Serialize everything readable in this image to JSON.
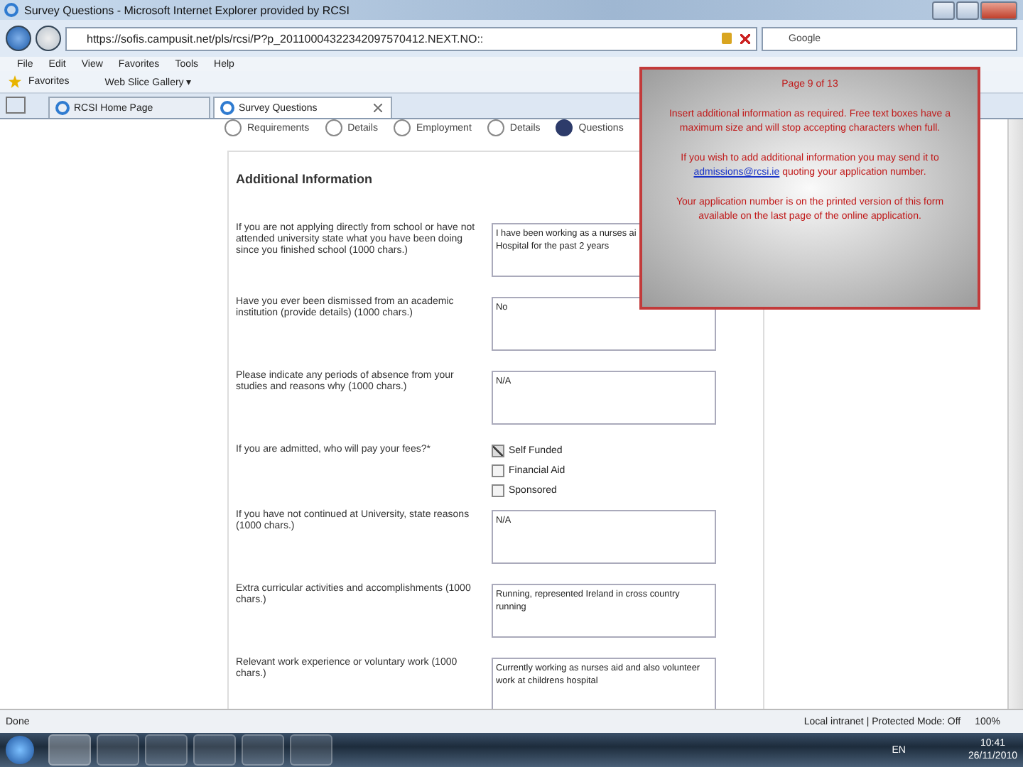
{
  "window": {
    "title": "Survey Questions - Microsoft Internet Explorer provided by RCSI"
  },
  "address_bar": {
    "url": "https://sofis.campusit.net/pls/rcsi/P?p_20110004322342097570412.NEXT.NO::",
    "search_placeholder": "Google"
  },
  "menu": [
    "File",
    "Edit",
    "View",
    "Favorites",
    "Tools",
    "Help"
  ],
  "favorites_bar": {
    "favorites": "Favorites",
    "web_slice": "Web Slice Gallery ▾"
  },
  "tabs": [
    {
      "label": "RCSI Home Page",
      "selected": false
    },
    {
      "label": "Survey Questions",
      "selected": true
    }
  ],
  "steps": [
    {
      "label": "Requirements",
      "selected": false
    },
    {
      "label": "Details",
      "selected": false
    },
    {
      "label": "Employment",
      "selected": false
    },
    {
      "label": "Details",
      "selected": false
    },
    {
      "label": "Questions",
      "selected": true
    }
  ],
  "form": {
    "heading": "Additional Information",
    "questions": [
      {
        "kind": "textarea",
        "label": "If you are not applying directly from school or have not attended university state what you have been doing since you finished school (1000 chars.)",
        "value": "I have been working as a nurses ai\nHospital for the past 2 years"
      },
      {
        "kind": "textarea",
        "label": "Have you ever been dismissed from an academic institution (provide details) (1000 chars.)",
        "value": "No"
      },
      {
        "kind": "textarea",
        "label": "Please indicate any periods of absence from your studies and reasons why (1000 chars.)",
        "value": "N/A"
      },
      {
        "kind": "checkboxes",
        "label": "If you are admitted, who will pay your fees?*",
        "options": [
          {
            "label": "Self Funded",
            "checked": true
          },
          {
            "label": "Financial Aid",
            "checked": false
          },
          {
            "label": "Sponsored",
            "checked": false
          }
        ]
      },
      {
        "kind": "textarea",
        "label": "If you have not continued at University, state reasons (1000 chars.)",
        "value": "N/A"
      },
      {
        "kind": "textarea",
        "label": "Extra curricular activities and accomplishments (1000 chars.)",
        "value": "Running, represented Ireland in cross country running"
      },
      {
        "kind": "textarea",
        "label": "Relevant work experience or voluntary work (1000 chars.)",
        "value": "Currently working as nurses aid and also volunteer work at childrens hospital"
      }
    ]
  },
  "popup": {
    "title": "Page 9 of 13",
    "paragraphs": [
      "Insert additional information as required.  Free text boxes have a maximum size and will stop accepting characters when full.",
      {
        "text": "If you wish to add additional information you may send it to ",
        "link": "admissions@rcsi.ie",
        "after": " quoting your application number."
      },
      "Your application number is on the printed version of this form available on the last page of the online application."
    ]
  },
  "status_bar": {
    "status": "Done",
    "zone": "Local intranet | Protected Mode: Off",
    "zoom": "100%"
  },
  "taskbar": {
    "language": "EN",
    "time": "10:41",
    "date": "26/11/2010"
  }
}
